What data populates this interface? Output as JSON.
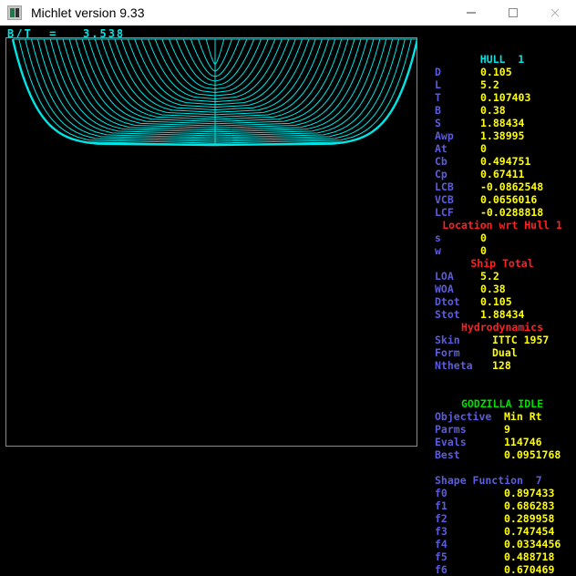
{
  "window": {
    "title": "Michlet version 9.33",
    "icon": "michlet-app-icon",
    "minimize_label": "—",
    "maximize_label": "□",
    "close_label": "✕"
  },
  "plot": {
    "bt_label": "B/T  =   3.538",
    "bt_ratio": 3.538,
    "line_color": "#00e5e5",
    "background": "#000000",
    "frame_color": "#8b8b8b",
    "description": "hull-body-plan-sections"
  },
  "panel": {
    "hull_header": "HULL  1",
    "hull": [
      {
        "label": "D",
        "value": "0.105"
      },
      {
        "label": "L",
        "value": "5.2"
      },
      {
        "label": "T",
        "value": "0.107403"
      },
      {
        "label": "B",
        "value": "0.38"
      },
      {
        "label": "S",
        "value": "1.88434"
      },
      {
        "label": "Awp",
        "value": "1.38995"
      },
      {
        "label": "At",
        "value": "0"
      },
      {
        "label": "Cb",
        "value": "0.494751"
      },
      {
        "label": "Cp",
        "value": "0.67411"
      },
      {
        "label": "LCB",
        "value": "-0.0862548"
      },
      {
        "label": "VCB",
        "value": "0.0656016"
      },
      {
        "label": "LCF",
        "value": "-0.0288818"
      }
    ],
    "location_header": "Location wrt Hull 1",
    "location": [
      {
        "label": "s",
        "value": "0"
      },
      {
        "label": "w",
        "value": "0"
      }
    ],
    "ship_total_header": "Ship Total",
    "ship_total": [
      {
        "label": "LOA",
        "value": "5.2"
      },
      {
        "label": "WOA",
        "value": "0.38"
      },
      {
        "label": "Dtot",
        "value": "0.105"
      },
      {
        "label": "Stot",
        "value": "1.88434"
      }
    ],
    "hydrodynamics_header": "Hydrodynamics",
    "hydrodynamics": [
      {
        "label": "Skin",
        "value": "ITTC 1957"
      },
      {
        "label": "Form",
        "value": "Dual"
      },
      {
        "label": "Ntheta",
        "value": "128"
      }
    ],
    "godzilla_header": "GODZILLA IDLE",
    "godzilla": [
      {
        "label": "Objective",
        "value": "Min Rt"
      },
      {
        "label": "Parms",
        "value": "9"
      },
      {
        "label": "Evals",
        "value": "114746"
      },
      {
        "label": "Best",
        "value": "0.0951768"
      }
    ],
    "shape_header": "Shape Function  7",
    "shape": [
      {
        "label": "f0",
        "value": "0.897433"
      },
      {
        "label": "f1",
        "value": "0.686283"
      },
      {
        "label": "f2",
        "value": "0.289958"
      },
      {
        "label": "f3",
        "value": "0.747454"
      },
      {
        "label": "f4",
        "value": "0.0334456"
      },
      {
        "label": "f5",
        "value": "0.488718"
      },
      {
        "label": "f6",
        "value": "0.670469"
      }
    ]
  },
  "colors": {
    "label": "#5c5ce0",
    "value": "#ffff00",
    "cyan": "#00e5e5",
    "red": "#ff2020",
    "green": "#00e000"
  }
}
